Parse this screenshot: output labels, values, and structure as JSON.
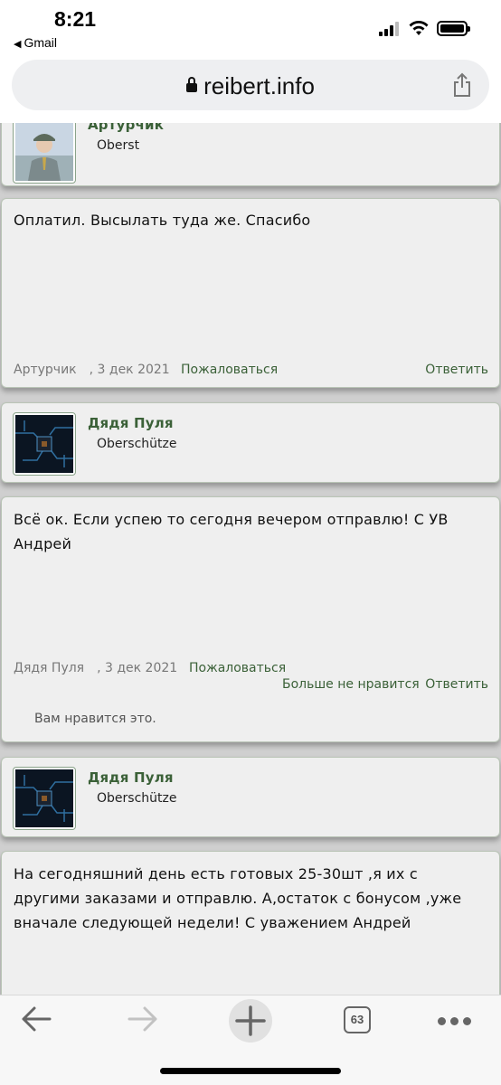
{
  "status_bar": {
    "time": "8:21",
    "back_app": "Gmail"
  },
  "browser": {
    "url": "reibert.info"
  },
  "posts": [
    {
      "user_name": "Артурчик",
      "user_title": "Oberst",
      "text": "Оплатил. Высылать туда же. Спасибо",
      "meta_author": "Артурчик",
      "meta_date": ", 3 дек 2021",
      "report_label": "Пожаловаться",
      "reply_label": "Ответить"
    },
    {
      "user_name": "Дядя Пуля",
      "user_title": "Oberschütze",
      "text": "Всё ок. Если успею то сегодня вечером отправлю! С УВ Андрей",
      "meta_author": "Дядя Пуля",
      "meta_date": ", 3 дек 2021",
      "report_label": "Пожаловаться",
      "unlike_label": "Больше не нравится",
      "reply_label": "Ответить",
      "liked_note": "Вам нравится это."
    },
    {
      "user_name": "Дядя Пуля",
      "user_title": "Oberschütze",
      "text": "На сегодняшний день есть готовых 25-30шт ,я их с другими заказами и отправлю. А,остаток с бонусом ,уже вначале следующей недели! С уважением Андрей"
    }
  ],
  "toolbar": {
    "tab_count": "63"
  },
  "colors": {
    "link_green": "#3b6138",
    "page_bg": "#cfcfcf",
    "card_bg": "#efefef"
  }
}
